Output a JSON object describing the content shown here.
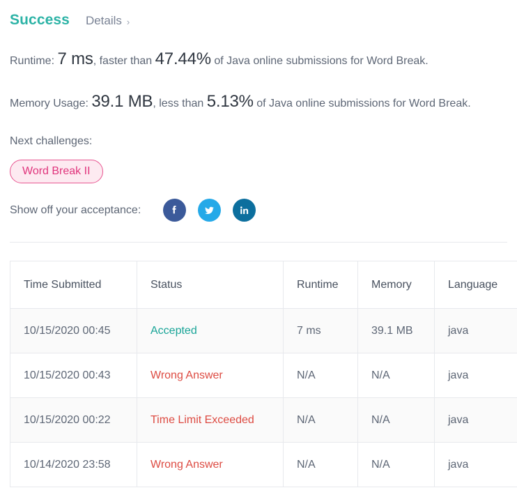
{
  "header": {
    "status_title": "Success",
    "details_label": "Details",
    "details_chevron": "chevron-right-icon",
    "details_chevron_glyph": "›"
  },
  "stats": {
    "runtime": {
      "label_prefix": "Runtime:",
      "value": "7 ms",
      "middle": ", faster than",
      "percent": "47.44%",
      "suffix": "of Java online submissions for Word Break."
    },
    "memory": {
      "label_prefix": "Memory Usage:",
      "value": "39.1 MB",
      "middle": ", less than",
      "percent": "5.13%",
      "suffix": "of Java online submissions for Word Break."
    }
  },
  "next_challenges": {
    "label": "Next challenges:",
    "items": [
      {
        "label": "Word Break II"
      }
    ]
  },
  "share": {
    "label": "Show off your acceptance:",
    "networks": [
      {
        "name": "facebook",
        "icon": "facebook-icon",
        "color": "#3b5a9a"
      },
      {
        "name": "twitter",
        "icon": "twitter-icon",
        "color": "#25a9e8"
      },
      {
        "name": "linkedin",
        "icon": "linkedin-icon",
        "color": "#0c6f9e"
      }
    ]
  },
  "submissions_table": {
    "columns": [
      "Time Submitted",
      "Status",
      "Runtime",
      "Memory",
      "Language"
    ],
    "rows": [
      {
        "time": "10/15/2020 00:45",
        "status": "Accepted",
        "status_kind": "accepted",
        "runtime": "7 ms",
        "memory": "39.1 MB",
        "language": "java"
      },
      {
        "time": "10/15/2020 00:43",
        "status": "Wrong Answer",
        "status_kind": "error",
        "runtime": "N/A",
        "memory": "N/A",
        "language": "java"
      },
      {
        "time": "10/15/2020 00:22",
        "status": "Time Limit Exceeded",
        "status_kind": "error",
        "runtime": "N/A",
        "memory": "N/A",
        "language": "java"
      },
      {
        "time": "10/14/2020 23:58",
        "status": "Wrong Answer",
        "status_kind": "error",
        "runtime": "N/A",
        "memory": "N/A",
        "language": "java"
      }
    ]
  },
  "colors": {
    "success_teal": "#2cb3a6",
    "accepted_teal": "#18a497",
    "error_red": "#dd4b42",
    "pill_border": "#e8538f",
    "pill_text": "#e0347c",
    "pill_bg": "#fdeaf1",
    "body_text": "#5d6675"
  }
}
